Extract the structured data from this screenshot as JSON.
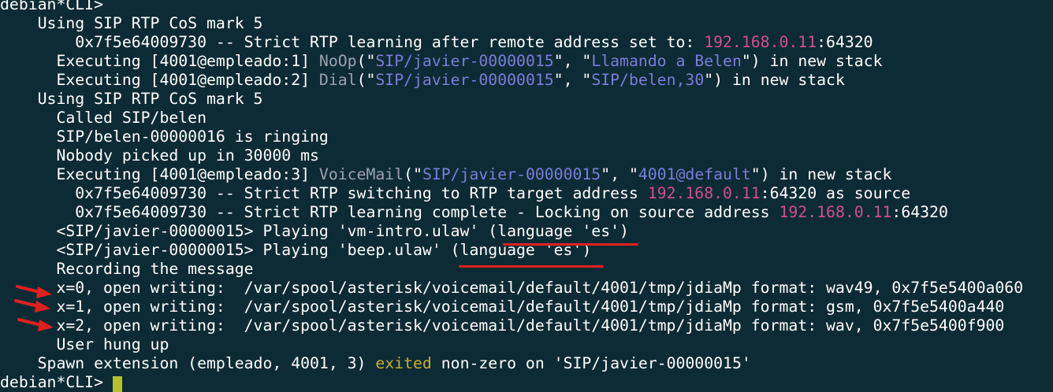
{
  "terminal": {
    "prompt": "debian*CLI>",
    "lines": [
      {
        "name": "cos-mark-1",
        "segments": [
          {
            "t": "    Using SIP RTP CoS mark 5",
            "c": "w"
          }
        ]
      },
      {
        "name": "rtp-learning-remote",
        "segments": [
          {
            "t": "        0x7f5e64009730 -- Strict RTP learning after remote address set to: ",
            "c": "w"
          },
          {
            "t": "192.168.0.11",
            "c": "m"
          },
          {
            "t": ":64320",
            "c": "w"
          }
        ]
      },
      {
        "name": "exec-noop",
        "segments": [
          {
            "t": "      Executing [4001@empleado:1] ",
            "c": "w"
          },
          {
            "t": "NoOp",
            "c": "g"
          },
          {
            "t": "(\"",
            "c": "w"
          },
          {
            "t": "SIP/javier-00000015",
            "c": "b"
          },
          {
            "t": "\", \"",
            "c": "w"
          },
          {
            "t": "Llamando a Belen",
            "c": "b"
          },
          {
            "t": "\") in new stack",
            "c": "w"
          }
        ]
      },
      {
        "name": "exec-dial",
        "segments": [
          {
            "t": "      Executing [4001@empleado:2] ",
            "c": "w"
          },
          {
            "t": "Dial",
            "c": "g"
          },
          {
            "t": "(\"",
            "c": "w"
          },
          {
            "t": "SIP/javier-00000015",
            "c": "b"
          },
          {
            "t": "\", \"",
            "c": "w"
          },
          {
            "t": "SIP/belen,30",
            "c": "b"
          },
          {
            "t": "\") in new stack",
            "c": "w"
          }
        ]
      },
      {
        "name": "cos-mark-2",
        "segments": [
          {
            "t": "    Using SIP RTP CoS mark 5",
            "c": "w"
          }
        ]
      },
      {
        "name": "called-belen",
        "segments": [
          {
            "t": "      Called SIP/belen",
            "c": "w"
          }
        ]
      },
      {
        "name": "belen-ringing",
        "segments": [
          {
            "t": "      SIP/belen-00000016 is ringing",
            "c": "w"
          }
        ]
      },
      {
        "name": "nobody-picked-up",
        "segments": [
          {
            "t": "      Nobody picked up in 30000 ms",
            "c": "w"
          }
        ]
      },
      {
        "name": "exec-voicemail",
        "segments": [
          {
            "t": "      Executing [4001@empleado:3] ",
            "c": "w"
          },
          {
            "t": "VoiceMail",
            "c": "g"
          },
          {
            "t": "(\"",
            "c": "w"
          },
          {
            "t": "SIP/javier-00000015",
            "c": "b"
          },
          {
            "t": "\", \"",
            "c": "w"
          },
          {
            "t": "4001@default",
            "c": "b"
          },
          {
            "t": "\") in new stack",
            "c": "w"
          }
        ]
      },
      {
        "name": "rtp-switching",
        "segments": [
          {
            "t": "        0x7f5e64009730 -- Strict RTP switching to RTP target address ",
            "c": "w"
          },
          {
            "t": "192.168.0.11",
            "c": "m"
          },
          {
            "t": ":64320 as source",
            "c": "w"
          }
        ]
      },
      {
        "name": "rtp-learning-complete",
        "segments": [
          {
            "t": "        0x7f5e64009730 -- Strict RTP learning complete - Locking on source address ",
            "c": "w"
          },
          {
            "t": "192.168.0.11",
            "c": "m"
          },
          {
            "t": ":64320",
            "c": "w"
          }
        ]
      },
      {
        "name": "playing-vm-intro",
        "segments": [
          {
            "t": "      <SIP/javier-00000015> Playing 'vm-intro.ulaw' (language 'es')",
            "c": "w"
          }
        ]
      },
      {
        "name": "playing-beep",
        "segments": [
          {
            "t": "      <SIP/javier-00000015> Playing 'beep.ulaw' (language 'es')",
            "c": "w"
          }
        ]
      },
      {
        "name": "recording-message",
        "segments": [
          {
            "t": "      Recording the message",
            "c": "w"
          }
        ]
      },
      {
        "name": "open-writing-0",
        "segments": [
          {
            "t": "      x=0, open writing:  /var/spool/asterisk/voicemail/default/4001/tmp/jdiaMp format: wav49, 0x7f5e5400a060",
            "c": "w"
          }
        ]
      },
      {
        "name": "open-writing-1",
        "segments": [
          {
            "t": "      x=1, open writing:  /var/spool/asterisk/voicemail/default/4001/tmp/jdiaMp format: gsm, 0x7f5e5400a440",
            "c": "w"
          }
        ]
      },
      {
        "name": "open-writing-2",
        "segments": [
          {
            "t": "      x=2, open writing:  /var/spool/asterisk/voicemail/default/4001/tmp/jdiaMp format: wav, 0x7f5e5400f900",
            "c": "w"
          }
        ]
      },
      {
        "name": "user-hung-up",
        "segments": [
          {
            "t": "      User hung up",
            "c": "w"
          }
        ]
      },
      {
        "name": "spawn-extension",
        "segments": [
          {
            "t": "    Spawn extension (empleado, 4001, 3) ",
            "c": "w"
          },
          {
            "t": "exited",
            "c": "y"
          },
          {
            "t": " non-zero on 'SIP/javier-00000015'",
            "c": "w"
          }
        ]
      }
    ]
  },
  "colors": {
    "background": "#0d2b35",
    "text": "#ffffff",
    "app_name": "#9aa3ad",
    "argument": "#7a7ed8",
    "ip_address": "#d24f8f",
    "status_exited": "#c6b032",
    "annotation": "#e02020",
    "cursor": "#b7c22a"
  },
  "annotations": {
    "underlines": [
      "language-es-underline-1",
      "language-es-underline-2"
    ],
    "arrows": [
      "red-arrow-icon",
      "red-arrow-icon",
      "red-arrow-icon"
    ]
  }
}
